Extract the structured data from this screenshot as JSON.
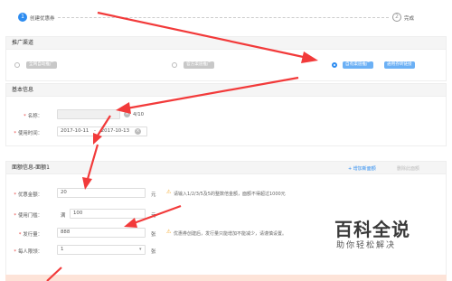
{
  "steps": [
    {
      "num": "1",
      "label": "创建优惠券",
      "active": true
    },
    {
      "num": "2",
      "label": "完成",
      "active": false
    }
  ],
  "channel": {
    "title": "推广渠道",
    "options": [
      {
        "label": "全网自动推广",
        "selected": false
      },
      {
        "label": "官方渠道推广",
        "selected": false
      },
      {
        "label": "自有渠道推广",
        "selected": true,
        "extra": "通用券转链接"
      }
    ]
  },
  "basic": {
    "title": "基本信息",
    "name": {
      "label": "名称",
      "value": "",
      "counter": "4/10"
    },
    "period": {
      "label": "使用时间",
      "start": "2017-10-11",
      "sep": "-",
      "end": "2017-10-13"
    }
  },
  "denom": {
    "title": "面额信息-面额1",
    "add_label": "+ 增加新面额",
    "del_label": "删除此面额",
    "rows": [
      {
        "key": "amount",
        "label": "优惠金额",
        "value": "20",
        "suffix": "元",
        "hint": "请输入1/2/3/5及5的整数倍金额，面额不得超过1000元"
      },
      {
        "key": "threshold",
        "label": "使用门槛",
        "prefix": "满",
        "value": "100",
        "suffix": "元",
        "hint": ""
      },
      {
        "key": "issue",
        "label": "发行量",
        "value": "888",
        "suffix": "张",
        "hint": "优惠券创建后，发行量只能增加不能减少，请谨慎设置。"
      },
      {
        "key": "limit",
        "label": "每人限领",
        "value": "1",
        "suffix": "张",
        "hint": ""
      }
    ]
  },
  "watermark": {
    "title": "百科全说",
    "subtitle": "助你轻松解决"
  },
  "colors": {
    "accent": "#2d8cf0",
    "arrow": "#f23a3a",
    "warn": "#f5a623"
  }
}
